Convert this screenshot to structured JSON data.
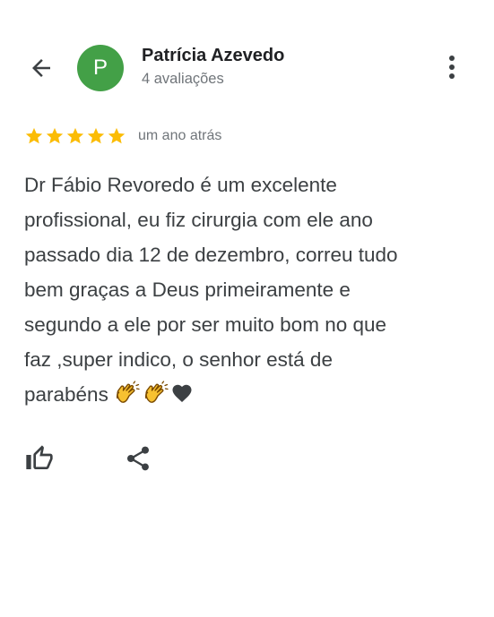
{
  "header": {
    "back_icon": "arrow-back-icon",
    "more_icon": "more-vert-icon"
  },
  "reviewer": {
    "initial": "P",
    "avatar_color": "#43A047",
    "name": "Patrícia Azevedo",
    "review_count": "4 avaliações"
  },
  "review": {
    "stars": 5,
    "max_stars": 5,
    "star_color": "#FBBC04",
    "date": "um ano atrás",
    "lines": [
      "Dr Fábio Revoredo é um excelente",
      "profissional, eu fiz cirurgia com ele ano",
      "passado dia 12 de dezembro, correu tudo",
      "bem graças a Deus primeiramente e",
      "segundo a ele por ser muito bom no que",
      "faz ,super indico, o senhor está de",
      "parabéns"
    ],
    "emojis": [
      "clapping-hands",
      "clapping-hands",
      "black-heart"
    ]
  },
  "actions": {
    "like_icon": "thumb-up-icon",
    "share_icon": "share-icon"
  }
}
